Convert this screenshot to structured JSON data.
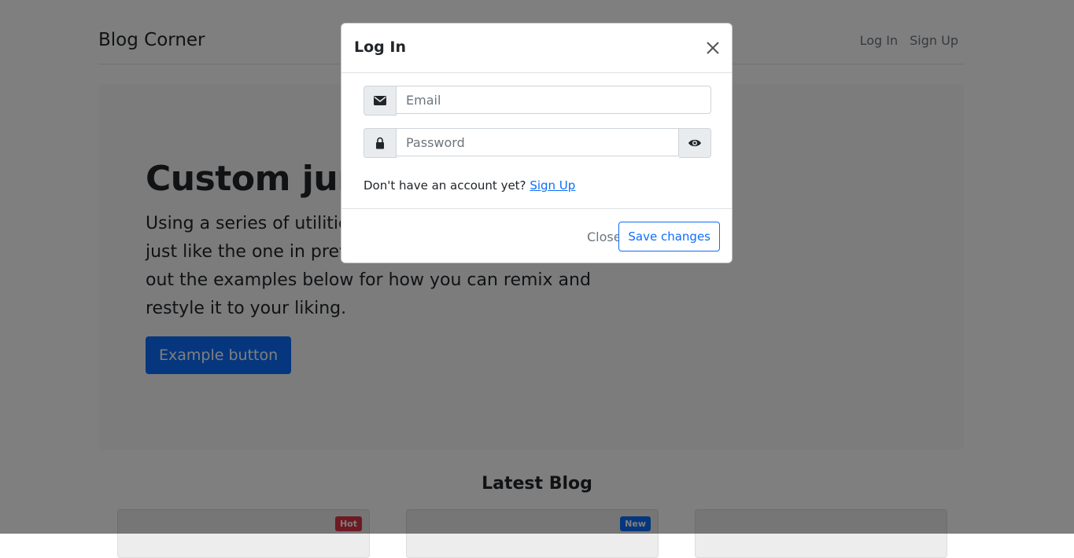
{
  "navbar": {
    "brand": "Blog Corner",
    "login": "Log In",
    "signup": "Sign Up"
  },
  "jumbotron": {
    "title": "Custom jumbotron",
    "text": "Using a series of utilities, you can create this jumbotron, just like the one in previous versions of Bootstrap. Check out the examples below for how you can remix and restyle it to your liking.",
    "button": "Example button"
  },
  "latest": {
    "heading": "Latest Blog"
  },
  "cards": [
    {
      "badge": "Hot",
      "badge_color": "#dc3545"
    },
    {
      "badge": "New",
      "badge_color": "#0d6efd"
    },
    {
      "badge": "",
      "badge_color": ""
    }
  ],
  "modal": {
    "title": "Log In",
    "email_placeholder": "Email",
    "password_placeholder": "Password",
    "no_account_text": "Don't have an account yet?",
    "signup_link": "Sign Up",
    "close_label": "Close",
    "save_label": "Save changes"
  },
  "colors": {
    "primary": "#0d6efd",
    "danger": "#dc3545",
    "backdrop": "rgba(0,0,0,0.5)"
  },
  "icons": {
    "email": "envelope-icon",
    "password": "lock-icon",
    "toggle": "eye-icon",
    "close": "close-icon"
  }
}
